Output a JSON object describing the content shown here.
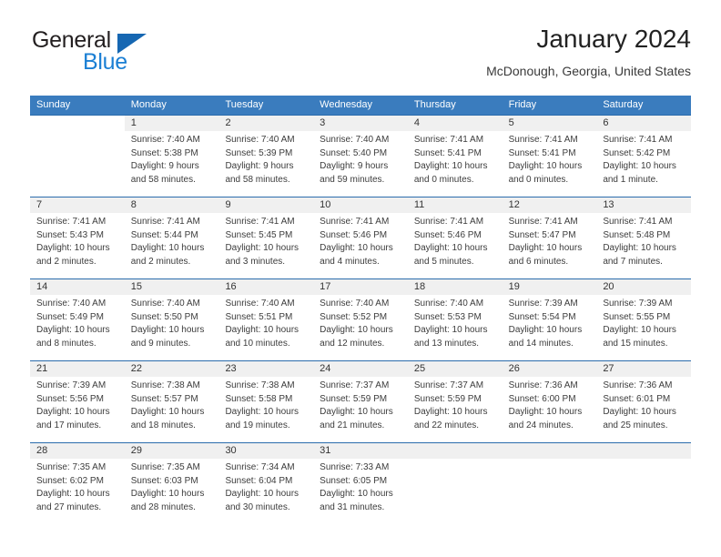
{
  "brand": {
    "name_top": "General",
    "name_bottom": "Blue",
    "flag_icon": "triangle-flag-icon",
    "color_dark": "#231f20",
    "color_blue": "#1b7fd4"
  },
  "header": {
    "title": "January 2024",
    "subtitle": "McDonough, Georgia, United States"
  },
  "theme": {
    "header_bg": "#3a7cbe",
    "week_divider": "#2b6cac",
    "daynum_bg": "#f0f0f0",
    "text": "#3c3c3c"
  },
  "weekdays": [
    {
      "label": "Sunday"
    },
    {
      "label": "Monday"
    },
    {
      "label": "Tuesday"
    },
    {
      "label": "Wednesday"
    },
    {
      "label": "Thursday"
    },
    {
      "label": "Friday"
    },
    {
      "label": "Saturday"
    }
  ],
  "weeks": [
    {
      "days": [
        {
          "num": "",
          "blank": true,
          "sunrise": "",
          "sunset": "",
          "daylight1": "",
          "daylight2": ""
        },
        {
          "num": "1",
          "blank": false,
          "sunrise": "Sunrise: 7:40 AM",
          "sunset": "Sunset: 5:38 PM",
          "daylight1": "Daylight: 9 hours",
          "daylight2": "and 58 minutes."
        },
        {
          "num": "2",
          "blank": false,
          "sunrise": "Sunrise: 7:40 AM",
          "sunset": "Sunset: 5:39 PM",
          "daylight1": "Daylight: 9 hours",
          "daylight2": "and 58 minutes."
        },
        {
          "num": "3",
          "blank": false,
          "sunrise": "Sunrise: 7:40 AM",
          "sunset": "Sunset: 5:40 PM",
          "daylight1": "Daylight: 9 hours",
          "daylight2": "and 59 minutes."
        },
        {
          "num": "4",
          "blank": false,
          "sunrise": "Sunrise: 7:41 AM",
          "sunset": "Sunset: 5:41 PM",
          "daylight1": "Daylight: 10 hours",
          "daylight2": "and 0 minutes."
        },
        {
          "num": "5",
          "blank": false,
          "sunrise": "Sunrise: 7:41 AM",
          "sunset": "Sunset: 5:41 PM",
          "daylight1": "Daylight: 10 hours",
          "daylight2": "and 0 minutes."
        },
        {
          "num": "6",
          "blank": false,
          "sunrise": "Sunrise: 7:41 AM",
          "sunset": "Sunset: 5:42 PM",
          "daylight1": "Daylight: 10 hours",
          "daylight2": "and 1 minute."
        }
      ]
    },
    {
      "days": [
        {
          "num": "7",
          "blank": false,
          "sunrise": "Sunrise: 7:41 AM",
          "sunset": "Sunset: 5:43 PM",
          "daylight1": "Daylight: 10 hours",
          "daylight2": "and 2 minutes."
        },
        {
          "num": "8",
          "blank": false,
          "sunrise": "Sunrise: 7:41 AM",
          "sunset": "Sunset: 5:44 PM",
          "daylight1": "Daylight: 10 hours",
          "daylight2": "and 2 minutes."
        },
        {
          "num": "9",
          "blank": false,
          "sunrise": "Sunrise: 7:41 AM",
          "sunset": "Sunset: 5:45 PM",
          "daylight1": "Daylight: 10 hours",
          "daylight2": "and 3 minutes."
        },
        {
          "num": "10",
          "blank": false,
          "sunrise": "Sunrise: 7:41 AM",
          "sunset": "Sunset: 5:46 PM",
          "daylight1": "Daylight: 10 hours",
          "daylight2": "and 4 minutes."
        },
        {
          "num": "11",
          "blank": false,
          "sunrise": "Sunrise: 7:41 AM",
          "sunset": "Sunset: 5:46 PM",
          "daylight1": "Daylight: 10 hours",
          "daylight2": "and 5 minutes."
        },
        {
          "num": "12",
          "blank": false,
          "sunrise": "Sunrise: 7:41 AM",
          "sunset": "Sunset: 5:47 PM",
          "daylight1": "Daylight: 10 hours",
          "daylight2": "and 6 minutes."
        },
        {
          "num": "13",
          "blank": false,
          "sunrise": "Sunrise: 7:41 AM",
          "sunset": "Sunset: 5:48 PM",
          "daylight1": "Daylight: 10 hours",
          "daylight2": "and 7 minutes."
        }
      ]
    },
    {
      "days": [
        {
          "num": "14",
          "blank": false,
          "sunrise": "Sunrise: 7:40 AM",
          "sunset": "Sunset: 5:49 PM",
          "daylight1": "Daylight: 10 hours",
          "daylight2": "and 8 minutes."
        },
        {
          "num": "15",
          "blank": false,
          "sunrise": "Sunrise: 7:40 AM",
          "sunset": "Sunset: 5:50 PM",
          "daylight1": "Daylight: 10 hours",
          "daylight2": "and 9 minutes."
        },
        {
          "num": "16",
          "blank": false,
          "sunrise": "Sunrise: 7:40 AM",
          "sunset": "Sunset: 5:51 PM",
          "daylight1": "Daylight: 10 hours",
          "daylight2": "and 10 minutes."
        },
        {
          "num": "17",
          "blank": false,
          "sunrise": "Sunrise: 7:40 AM",
          "sunset": "Sunset: 5:52 PM",
          "daylight1": "Daylight: 10 hours",
          "daylight2": "and 12 minutes."
        },
        {
          "num": "18",
          "blank": false,
          "sunrise": "Sunrise: 7:40 AM",
          "sunset": "Sunset: 5:53 PM",
          "daylight1": "Daylight: 10 hours",
          "daylight2": "and 13 minutes."
        },
        {
          "num": "19",
          "blank": false,
          "sunrise": "Sunrise: 7:39 AM",
          "sunset": "Sunset: 5:54 PM",
          "daylight1": "Daylight: 10 hours",
          "daylight2": "and 14 minutes."
        },
        {
          "num": "20",
          "blank": false,
          "sunrise": "Sunrise: 7:39 AM",
          "sunset": "Sunset: 5:55 PM",
          "daylight1": "Daylight: 10 hours",
          "daylight2": "and 15 minutes."
        }
      ]
    },
    {
      "days": [
        {
          "num": "21",
          "blank": false,
          "sunrise": "Sunrise: 7:39 AM",
          "sunset": "Sunset: 5:56 PM",
          "daylight1": "Daylight: 10 hours",
          "daylight2": "and 17 minutes."
        },
        {
          "num": "22",
          "blank": false,
          "sunrise": "Sunrise: 7:38 AM",
          "sunset": "Sunset: 5:57 PM",
          "daylight1": "Daylight: 10 hours",
          "daylight2": "and 18 minutes."
        },
        {
          "num": "23",
          "blank": false,
          "sunrise": "Sunrise: 7:38 AM",
          "sunset": "Sunset: 5:58 PM",
          "daylight1": "Daylight: 10 hours",
          "daylight2": "and 19 minutes."
        },
        {
          "num": "24",
          "blank": false,
          "sunrise": "Sunrise: 7:37 AM",
          "sunset": "Sunset: 5:59 PM",
          "daylight1": "Daylight: 10 hours",
          "daylight2": "and 21 minutes."
        },
        {
          "num": "25",
          "blank": false,
          "sunrise": "Sunrise: 7:37 AM",
          "sunset": "Sunset: 5:59 PM",
          "daylight1": "Daylight: 10 hours",
          "daylight2": "and 22 minutes."
        },
        {
          "num": "26",
          "blank": false,
          "sunrise": "Sunrise: 7:36 AM",
          "sunset": "Sunset: 6:00 PM",
          "daylight1": "Daylight: 10 hours",
          "daylight2": "and 24 minutes."
        },
        {
          "num": "27",
          "blank": false,
          "sunrise": "Sunrise: 7:36 AM",
          "sunset": "Sunset: 6:01 PM",
          "daylight1": "Daylight: 10 hours",
          "daylight2": "and 25 minutes."
        }
      ]
    },
    {
      "days": [
        {
          "num": "28",
          "blank": false,
          "sunrise": "Sunrise: 7:35 AM",
          "sunset": "Sunset: 6:02 PM",
          "daylight1": "Daylight: 10 hours",
          "daylight2": "and 27 minutes."
        },
        {
          "num": "29",
          "blank": false,
          "sunrise": "Sunrise: 7:35 AM",
          "sunset": "Sunset: 6:03 PM",
          "daylight1": "Daylight: 10 hours",
          "daylight2": "and 28 minutes."
        },
        {
          "num": "30",
          "blank": false,
          "sunrise": "Sunrise: 7:34 AM",
          "sunset": "Sunset: 6:04 PM",
          "daylight1": "Daylight: 10 hours",
          "daylight2": "and 30 minutes."
        },
        {
          "num": "31",
          "blank": false,
          "sunrise": "Sunrise: 7:33 AM",
          "sunset": "Sunset: 6:05 PM",
          "daylight1": "Daylight: 10 hours",
          "daylight2": "and 31 minutes."
        },
        {
          "num": "",
          "blank": false,
          "sunrise": "",
          "sunset": "",
          "daylight1": "",
          "daylight2": ""
        },
        {
          "num": "",
          "blank": false,
          "sunrise": "",
          "sunset": "",
          "daylight1": "",
          "daylight2": ""
        },
        {
          "num": "",
          "blank": false,
          "sunrise": "",
          "sunset": "",
          "daylight1": "",
          "daylight2": ""
        }
      ]
    }
  ]
}
